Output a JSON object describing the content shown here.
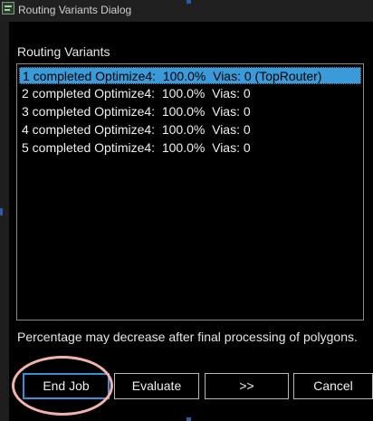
{
  "window": {
    "title": "Routing Variants Dialog",
    "app_icon": "app-icon"
  },
  "routing_variants": {
    "label": "Routing Variants",
    "items": [
      {
        "text": "1 completed Optimize4:  100.0%  Vias: 0 (TopRouter)",
        "selected": true
      },
      {
        "text": "2 completed Optimize4:  100.0%  Vias: 0",
        "selected": false
      },
      {
        "text": "3 completed Optimize4:  100.0%  Vias: 0",
        "selected": false
      },
      {
        "text": "4 completed Optimize4:  100.0%  Vias: 0",
        "selected": false
      },
      {
        "text": "5 completed Optimize4:  100.0%  Vias: 0",
        "selected": false
      }
    ]
  },
  "note": "Percentage may decrease after final processing of polygons.",
  "buttons": {
    "end_job": "End Job",
    "evaluate": "Evaluate",
    "next": ">>",
    "cancel": "Cancel"
  },
  "colors": {
    "selection": "#3a9bd8",
    "annotation_ring": "#f2b3ad"
  }
}
